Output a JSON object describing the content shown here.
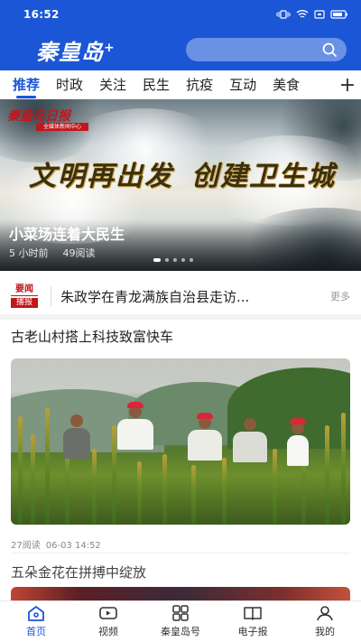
{
  "status": {
    "time": "16:52"
  },
  "app": {
    "brand": "秦皇岛",
    "brand_plus": "+"
  },
  "colors": {
    "accent": "#1a56d6",
    "badge_red": "#c0171d"
  },
  "tabs": [
    "推荐",
    "时政",
    "关注",
    "民生",
    "抗疫",
    "互动",
    "美食"
  ],
  "banner": {
    "logo": "秦皇岛日报",
    "logo_sub": "全媒体新闻中心",
    "slogan_left": "文明再出发",
    "slogan_right": "创建卫生城",
    "title": "小菜场连着大民生",
    "time": "5 小时前",
    "reads": "49阅读"
  },
  "headline": {
    "badge_top": "要闻",
    "badge_bottom": "播报",
    "text": "朱政学在青龙满族自治县走访...",
    "more": "更多"
  },
  "articles": [
    {
      "title": "古老山村搭上科技致富快车",
      "reads": "27阅读",
      "date": "06-03 14:52"
    },
    {
      "title": "五朵金花在拼搏中绽放"
    }
  ],
  "bottom_nav": [
    {
      "label": "首页",
      "icon": "home-icon"
    },
    {
      "label": "视频",
      "icon": "video-icon"
    },
    {
      "label": "秦皇岛号",
      "icon": "grid-icon"
    },
    {
      "label": "电子报",
      "icon": "newspaper-icon"
    },
    {
      "label": "我的",
      "icon": "user-icon"
    }
  ]
}
